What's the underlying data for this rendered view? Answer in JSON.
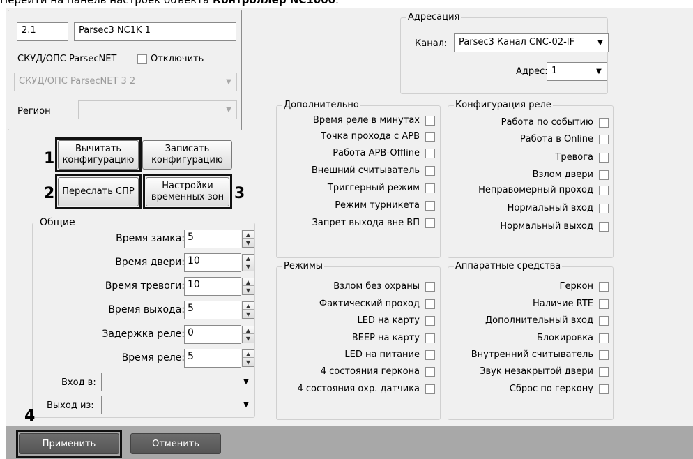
{
  "doc": {
    "text_prefix": "Перейти на панель настроек объекта ",
    "text_bold": "Контроллер NC1000",
    "text_suffix": "."
  },
  "top": {
    "id_value": "2.1",
    "name_value": "Parsec3 NC1K 1",
    "parent_label": "СКУД/ОПС ParsecNET",
    "disable_label": "Отключить",
    "parent_combo_value": "СКУД/ОПС ParsecNET 3 2",
    "region_label": "Регион",
    "region_value": ""
  },
  "addressing": {
    "title": "Адресация",
    "channel_label": "Канал:",
    "channel_value": "Parsec3 Канал CNC-02-IF",
    "address_label": "Адрес:",
    "address_value": "1"
  },
  "actions": {
    "read_config": "Вычитать конфигурацию",
    "write_config": "Записать конфигурацию",
    "send_spr": "Переслать СПР",
    "time_zones": "Настройки временных зон",
    "marker1": "1",
    "marker2": "2",
    "marker3": "3",
    "marker4": "4"
  },
  "general": {
    "title": "Общие",
    "fields": [
      {
        "label": "Время замка:",
        "value": "5"
      },
      {
        "label": "Время двери:",
        "value": "10"
      },
      {
        "label": "Время тревоги:",
        "value": "10"
      },
      {
        "label": "Время выхода:",
        "value": "5"
      },
      {
        "label": "Задержка реле:",
        "value": "0"
      },
      {
        "label": "Время реле:",
        "value": "5"
      }
    ],
    "entry_label": "Вход в:",
    "entry_value": "",
    "exit_label": "Выход из:",
    "exit_value": ""
  },
  "additional": {
    "title": "Дополнительно",
    "items": [
      "Время реле в минутах",
      "Точка прохода с APB",
      "Работа APB-Offline",
      "Внешний считыватель",
      "Триггерный режим",
      "Режим турникета",
      "Запрет выхода вне ВП"
    ]
  },
  "relay": {
    "title": "Конфигурация реле",
    "items": [
      "Работа по событию",
      "Работа в Online",
      "Тревога",
      "Взлом двери",
      "Неправомерный проход",
      "Нормальный вход",
      "Нормальный выход"
    ]
  },
  "modes": {
    "title": "Режимы",
    "items": [
      "Взлом без охраны",
      "Фактический проход",
      "LED на карту",
      "BEEP на карту",
      "LED на питание",
      "4 состояния геркона",
      "4 состояния охр. датчика"
    ]
  },
  "hardware": {
    "title": "Аппаратные средства",
    "items": [
      "Геркон",
      "Наличие RTE",
      "Дополнительный вход",
      "Блокировка",
      "Внутренний считыватель",
      "Звук незакрытой двери",
      "Сброс по геркону"
    ]
  },
  "footer": {
    "apply": "Применить",
    "cancel": "Отменить"
  },
  "icons": {
    "dropdown": "chevron-down-icon",
    "spin": "spin-arrows-icon"
  }
}
